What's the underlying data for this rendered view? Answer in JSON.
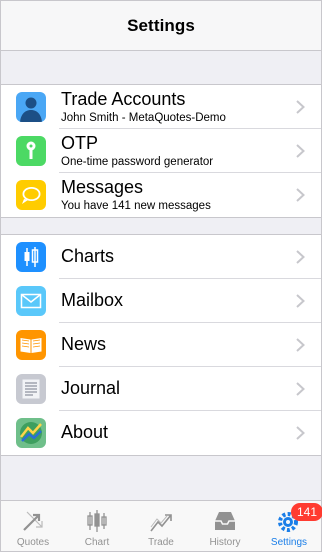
{
  "header": {
    "title": "Settings"
  },
  "group1": [
    {
      "label": "Trade Accounts",
      "sub": "John  Smith - MetaQuotes-Demo",
      "icon": "person-icon",
      "color": "#4aa7f5"
    },
    {
      "label": "OTP",
      "sub": "One-time password generator",
      "icon": "key-icon",
      "color": "#4cd964"
    },
    {
      "label": "Messages",
      "sub": "You have 141 new messages",
      "icon": "speech-bubble-icon",
      "color": "#ffcc00"
    }
  ],
  "group2": [
    {
      "label": "Charts",
      "icon": "candlestick-icon",
      "color": "#1e90ff"
    },
    {
      "label": "Mailbox",
      "icon": "envelope-icon",
      "color": "#5ac8fa"
    },
    {
      "label": "News",
      "icon": "book-icon",
      "color": "#ff9500"
    },
    {
      "label": "Journal",
      "icon": "document-lines-icon",
      "color": "#c7c9d1"
    },
    {
      "label": "About",
      "icon": "metatrader-logo-icon",
      "color": "#6fbf8a"
    }
  ],
  "tabs": [
    {
      "label": "Quotes",
      "icon": "quotes-arrows-icon"
    },
    {
      "label": "Chart",
      "icon": "chart-candles-icon"
    },
    {
      "label": "Trade",
      "icon": "trade-trend-icon"
    },
    {
      "label": "History",
      "icon": "history-inbox-icon"
    },
    {
      "label": "Settings",
      "icon": "gears-icon",
      "badge": "141",
      "active": true
    }
  ],
  "colors": {
    "accent": "#1a7ee8",
    "badge": "#ff3b30"
  }
}
